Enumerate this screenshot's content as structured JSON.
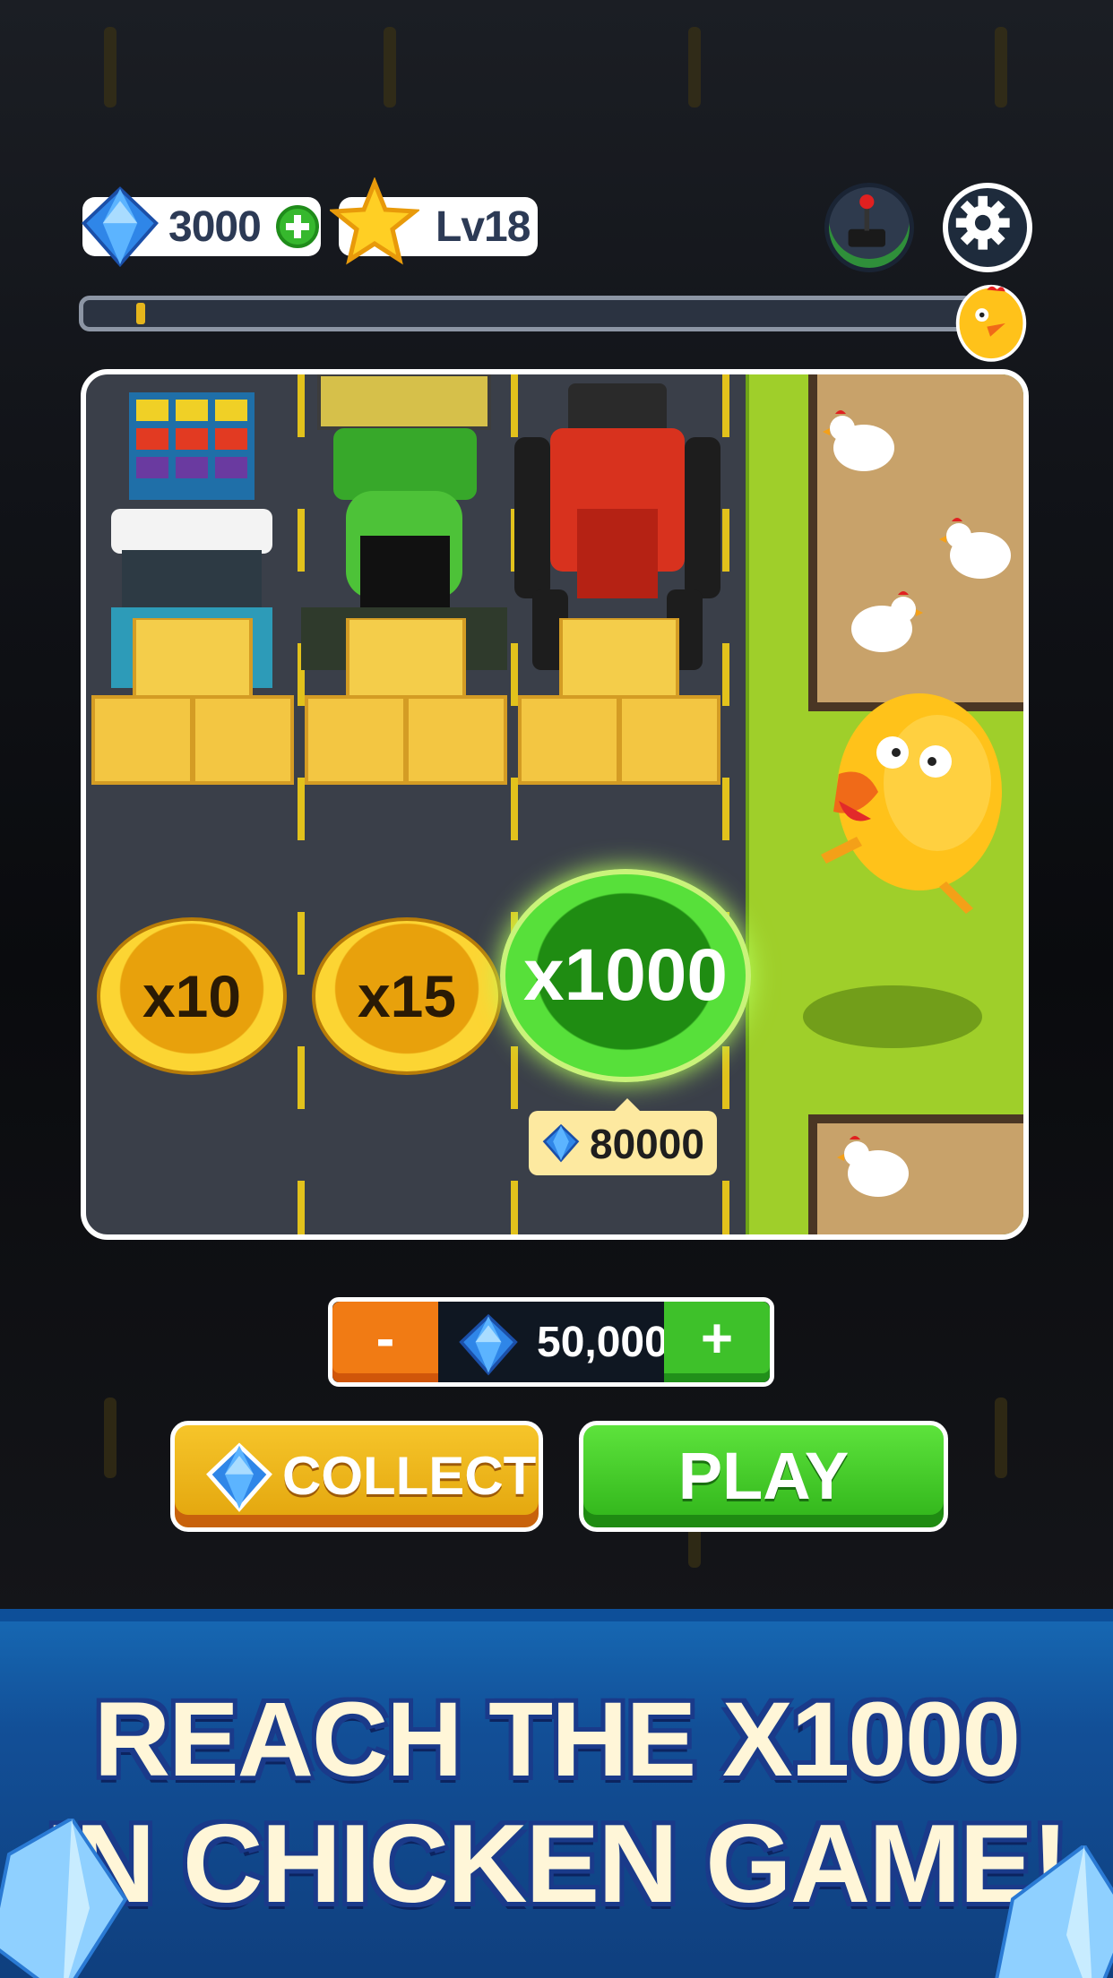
{
  "top_bar": {
    "gems": "3000",
    "level": "Lv18"
  },
  "progress": {
    "fraction": 0.06
  },
  "board": {
    "multipliers": [
      {
        "label": "x10",
        "state": "reached"
      },
      {
        "label": "x15",
        "state": "reached"
      },
      {
        "label": "x1000",
        "state": "current"
      }
    ],
    "current_price": "80000"
  },
  "bet": {
    "minus_label": "-",
    "value": "50,000",
    "plus_label": "+"
  },
  "buttons": {
    "collect": "COLLECT",
    "play": "PLAY"
  },
  "banner": {
    "line1": "REACH THE X1000",
    "line2": "IN CHICKEN GAME!"
  },
  "colors": {
    "gold": "#f6c52a",
    "green": "#3ec12a",
    "orange": "#f17b14",
    "banner_blue": "#124f97"
  }
}
